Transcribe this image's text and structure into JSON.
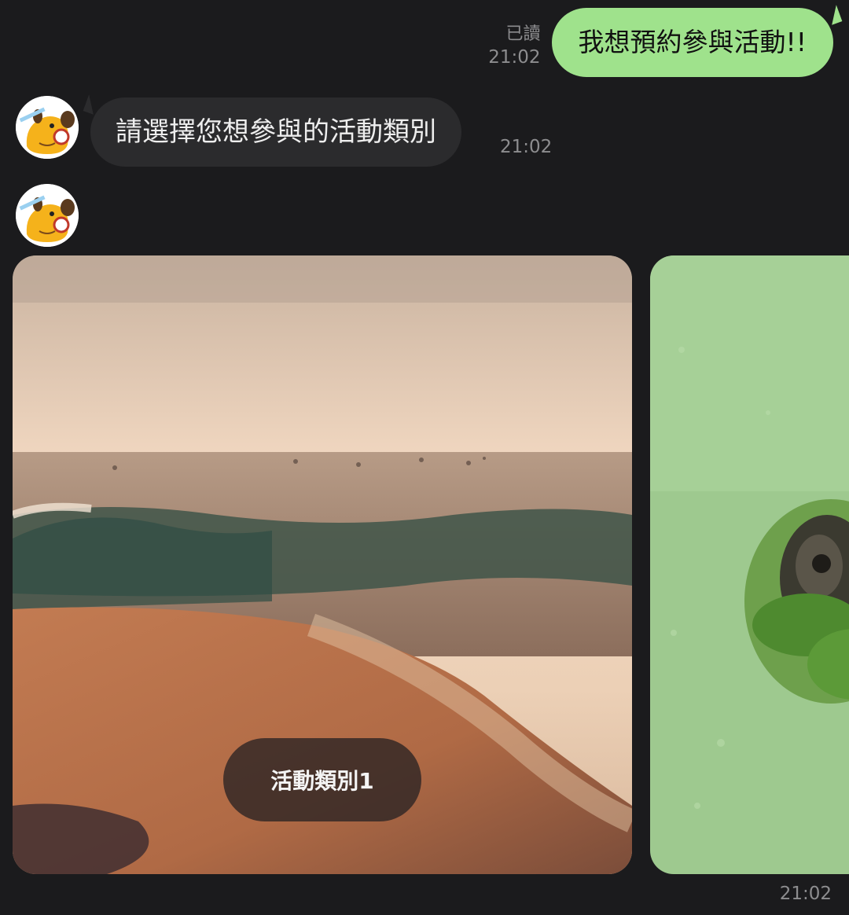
{
  "outgoing": {
    "read_label": "已讀",
    "time": "21:02",
    "text": "我想預約參與活動!!"
  },
  "incoming": {
    "text": "請選擇您想參與的活動類別",
    "time": "21:02"
  },
  "carousel": {
    "cards": [
      {
        "button_label": "活動類別1",
        "image": "ocean-waves-photo"
      },
      {
        "button_label": "",
        "image": "turtle-in-algae-photo"
      }
    ],
    "time": "21:02"
  },
  "colors": {
    "background": "#1b1b1d",
    "outgoing_bubble": "#9fe28c",
    "incoming_bubble": "#2b2b2d",
    "card_button": "#302624"
  }
}
